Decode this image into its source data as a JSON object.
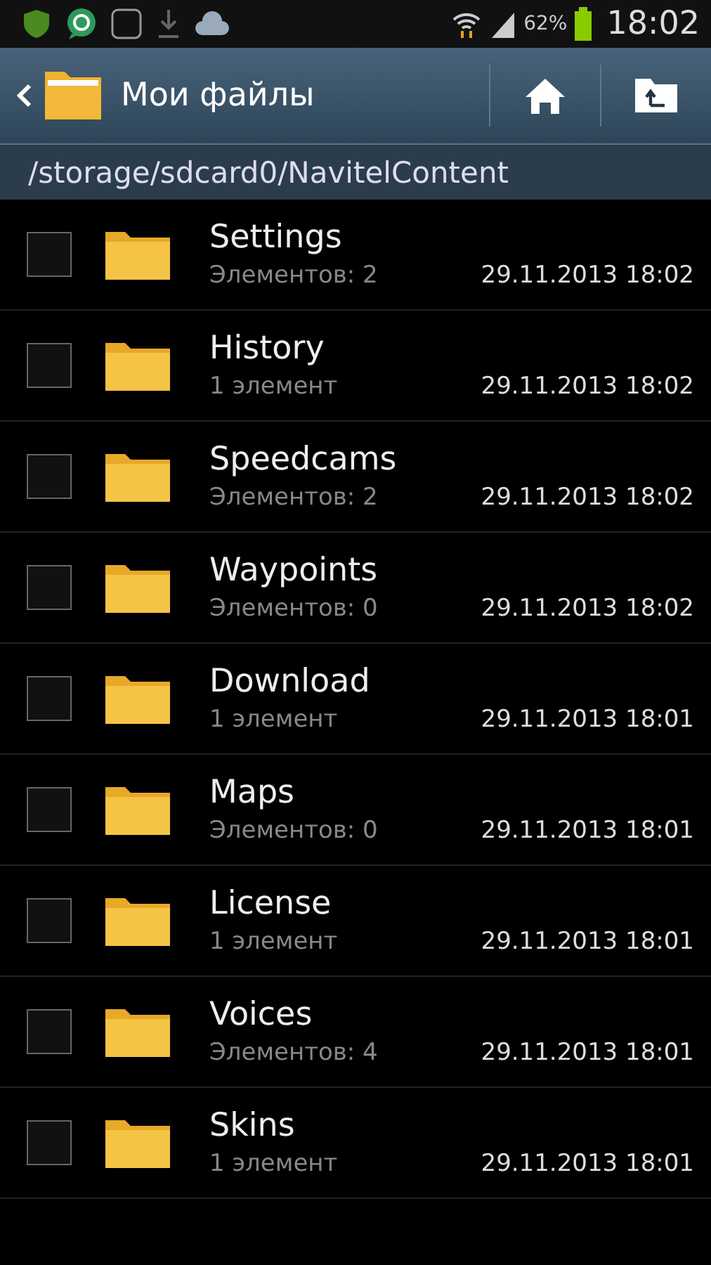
{
  "status_bar": {
    "battery": "62%",
    "time": "18:02"
  },
  "app_bar": {
    "title": "Мои файлы"
  },
  "path": "/storage/sdcard0/NavitelContent",
  "items": [
    {
      "name": "Settings",
      "count": "Элементов: 2",
      "date": "29.11.2013 18:02",
      "checked": false
    },
    {
      "name": "History",
      "count": "1 элемент",
      "date": "29.11.2013 18:02",
      "checked": false
    },
    {
      "name": "Speedcams",
      "count": "Элементов: 2",
      "date": "29.11.2013 18:02",
      "checked": false
    },
    {
      "name": "Waypoints",
      "count": "Элементов: 0",
      "date": "29.11.2013 18:02",
      "checked": false
    },
    {
      "name": "Download",
      "count": "1 элемент",
      "date": "29.11.2013 18:01",
      "checked": false
    },
    {
      "name": "Maps",
      "count": "Элементов: 0",
      "date": "29.11.2013 18:01",
      "checked": false
    },
    {
      "name": "License",
      "count": "1 элемент",
      "date": "29.11.2013 18:01",
      "checked": false
    },
    {
      "name": "Voices",
      "count": "Элементов: 4",
      "date": "29.11.2013 18:01",
      "checked": false
    },
    {
      "name": "Skins",
      "count": "1 элемент",
      "date": "29.11.2013 18:01",
      "checked": false
    }
  ]
}
